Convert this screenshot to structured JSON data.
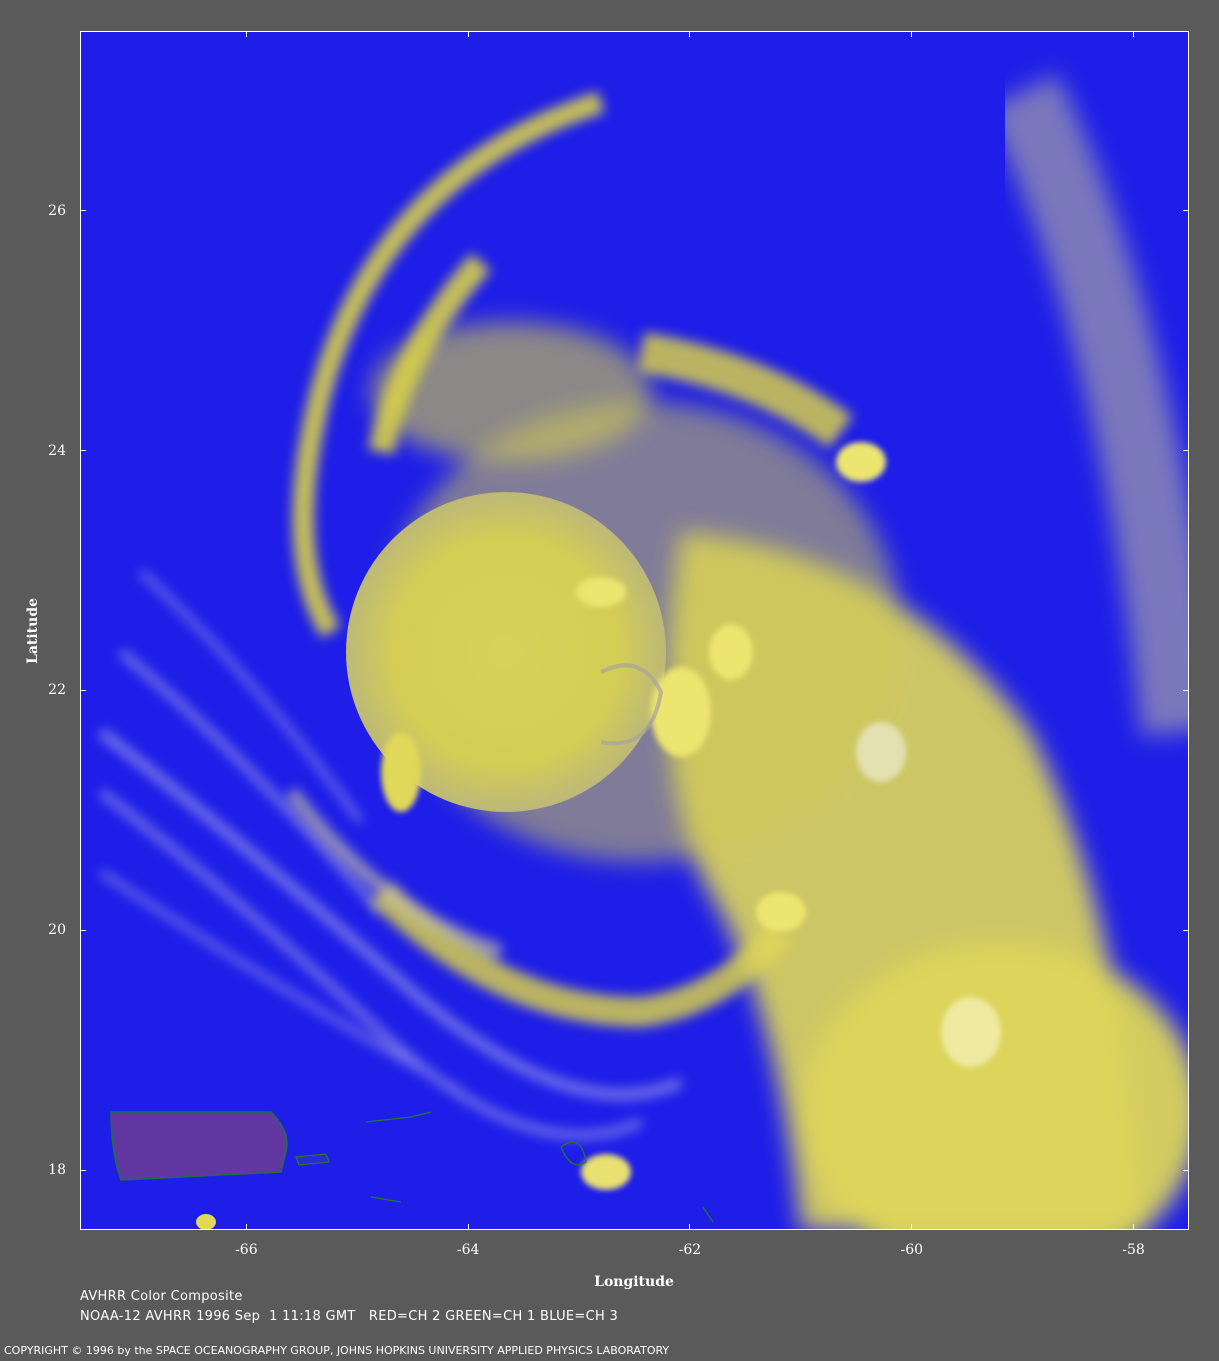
{
  "map": {
    "x_axis_title": "Longitude",
    "y_axis_title": "Latitude",
    "x_ticks": [
      "-66",
      "-64",
      "-62",
      "-60",
      "-58"
    ],
    "x_tick_values": [
      -66,
      -64,
      -62,
      -60,
      -58
    ],
    "y_ticks": [
      "26",
      "24",
      "22",
      "20",
      "18"
    ],
    "y_tick_values": [
      26,
      24,
      22,
      20,
      18
    ],
    "lon_range": [
      -67.5,
      -57.5
    ],
    "lat_range": [
      17.5,
      27.5
    ],
    "colors": {
      "ocean": "#1e1ee8",
      "cloud": "#e2dc5a",
      "background": "#5a5a5a",
      "coastline": "#1f7a2a"
    }
  },
  "caption": {
    "title": "AVHRR Color Composite",
    "details": "NOAA-12 AVHRR 1996 Sep  1 11:18 GMT   RED=CH 2 GREEN=CH 1 BLUE=CH 3"
  },
  "copyright": "COPYRIGHT © 1996 by the SPACE OCEANOGRAPHY GROUP, JOHNS HOPKINS UNIVERSITY APPLIED PHYSICS LABORATORY"
}
